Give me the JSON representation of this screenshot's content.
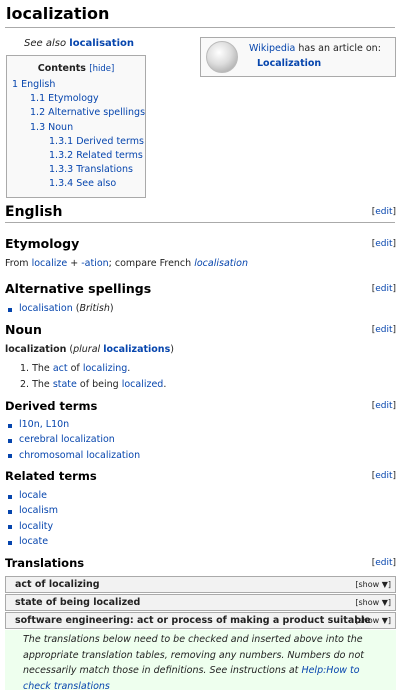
{
  "page": {
    "title": "localization"
  },
  "see_also": {
    "prefix": "See also",
    "link": "localisation"
  },
  "wikipedia_box": {
    "site": "Wikipedia",
    "text": "has an article on:",
    "article": "Localization"
  },
  "toc": {
    "title": "Contents",
    "hide": "[hide]",
    "items": [
      {
        "num": "1",
        "label": "English"
      },
      {
        "num": "1.1",
        "label": "Etymology"
      },
      {
        "num": "1.2",
        "label": "Alternative spellings"
      },
      {
        "num": "1.3",
        "label": "Noun"
      },
      {
        "num": "1.3.1",
        "label": "Derived terms"
      },
      {
        "num": "1.3.2",
        "label": "Related terms"
      },
      {
        "num": "1.3.3",
        "label": "Translations"
      },
      {
        "num": "1.3.4",
        "label": "See also"
      }
    ]
  },
  "edit": {
    "open": "[",
    "label": "edit",
    "close": "]"
  },
  "sections": {
    "english": "English",
    "etymology": "Etymology",
    "alternative_spellings": "Alternative spellings",
    "noun": "Noun",
    "derived_terms": "Derived terms",
    "related_terms": "Related terms",
    "translations": "Translations"
  },
  "etymology": {
    "from": "From",
    "w1": "localize",
    "plus": "+",
    "w2": "-ation",
    "compare": "; compare French",
    "french": "localisation"
  },
  "alt_spellings": [
    {
      "word": "localisation",
      "qual": "British"
    }
  ],
  "noun": {
    "headword": "localization",
    "plural_label": "plural",
    "plural": "localizations",
    "senses": [
      {
        "n": "1.",
        "pre": "The",
        "link": "act",
        "mid": "of",
        "link2": "localizing",
        "end": "."
      },
      {
        "n": "2.",
        "pre": "The",
        "link": "state",
        "mid": "of being",
        "link2": "localized",
        "end": "."
      }
    ]
  },
  "derived_terms": [
    "l10n, L10n",
    "cerebral localization",
    "chromosomal localization"
  ],
  "related_terms": [
    "locale",
    "localism",
    "locality",
    "locate"
  ],
  "translation_tables": [
    {
      "label": "act of localizing",
      "show": "[show ▼]"
    },
    {
      "label": "state of being localized",
      "show": "[show ▼]"
    },
    {
      "label": "software engineering: act or process of making a product suitable",
      "show": "[show ▼]"
    }
  ],
  "note": {
    "line1": "The translations below need to be checked and inserted above into the",
    "line2": "appropriate translation tables, removing any numbers. Numbers do not",
    "line3_pre": "necessarily match those in definitions. See instructions at",
    "link": "Help:How to",
    "line4": "check translations"
  }
}
